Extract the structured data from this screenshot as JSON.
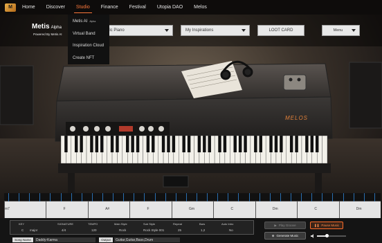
{
  "nav": {
    "logo_text": "M",
    "items": [
      {
        "label": "Home"
      },
      {
        "label": "Discover"
      },
      {
        "label": "Studio",
        "active": true
      },
      {
        "label": "Finance"
      },
      {
        "label": "Festival"
      },
      {
        "label": "Utopia DAO"
      },
      {
        "label": "Melos"
      }
    ]
  },
  "studio_menu": {
    "items": [
      {
        "label": "Metis AI",
        "badge": "Alpha"
      },
      {
        "label": "Virtual Band"
      },
      {
        "label": "Inspiration Cloud"
      },
      {
        "label": "Create NFT"
      }
    ]
  },
  "brand": {
    "title": "Metis",
    "title_suffix": "Alpha",
    "subtitle": "Powered By Metis AI"
  },
  "controls": {
    "instrument": "lectric Piano",
    "inspiration": "My Inspirations",
    "loot_card": "LOOT CARD",
    "menu": "Menu"
  },
  "instrument_brand": "MELOS",
  "timeline": {
    "chords": [
      "m7",
      "F",
      "A#",
      "F",
      "Gm",
      "C",
      "Dm",
      "C",
      "Dm"
    ]
  },
  "song_table": {
    "headers": [
      "KEY",
      "SIGNATURE",
      "TEMPO",
      "Main Style",
      "Sub Style",
      "Repeat",
      "Bars",
      "Auto Intro"
    ],
    "row": [
      "C",
      "major",
      "4/4",
      "120",
      "Rock",
      "Rock Style 001",
      "25",
      "1,2",
      "No"
    ]
  },
  "song_name": {
    "label": "Song Name",
    "value": "Daddy-Karma"
  },
  "output": {
    "label": "Output",
    "value": "Guitar,Guitar,Bass,Drum"
  },
  "buttons": {
    "play_groove": "Play Groove",
    "pause_music": "Pause Music",
    "generate_music": "Generate Music"
  },
  "volume": {
    "level": 0.35
  },
  "colors": {
    "accent": "#ff7a3c",
    "timeline_tick": "#2a6fb1"
  }
}
